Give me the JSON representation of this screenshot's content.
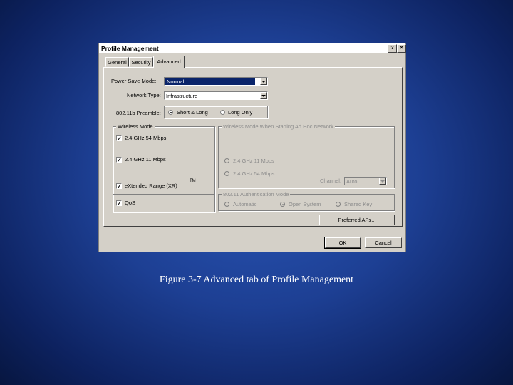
{
  "dialog": {
    "title": "Profile Management",
    "help_glyph": "?",
    "close_glyph": "✕",
    "tabs": [
      "General",
      "Security",
      "Advanced"
    ],
    "active_tab": "Advanced",
    "power_save": {
      "label": "Power Save Mode:",
      "value": "Normal"
    },
    "network_type": {
      "label": "Network Type:",
      "value": "Infrastructure"
    },
    "preamble": {
      "label": "802.11b Preamble:",
      "options": [
        "Short & Long",
        "Long Only"
      ],
      "selected": "Short & Long"
    },
    "wireless_mode": {
      "title": "Wireless Mode",
      "items": [
        {
          "label": "2.4 GHz 54 Mbps",
          "checked": true
        },
        {
          "label": "2.4 GHz 11 Mbps",
          "checked": true
        }
      ],
      "xr_label": "eXtended Range (XR)",
      "xr_tm": "TM",
      "qos_label": "QoS"
    },
    "adhoc": {
      "title": "Wireless Mode When Starting Ad Hoc Network",
      "options": [
        "2.4 GHz 11 Mbps",
        "2.4 GHz 54 Mbps"
      ],
      "channel_label": "Channel:",
      "channel_value": "Auto"
    },
    "auth": {
      "title": "802.11 Authentication Mode",
      "options": [
        "Automatic",
        "Open System",
        "Shared Key"
      ],
      "selected": "Open System"
    },
    "preferred_aps_label": "Preferred APs...",
    "ok_label": "OK",
    "cancel_label": "Cancel",
    "check_glyph": "✓"
  },
  "caption": "Figure 3-7 Advanced tab of Profile Management",
  "colors": {
    "dialog_bg": "#d4d0c8",
    "selection": "#0a246a",
    "slide_bg": "#1d3f93"
  }
}
